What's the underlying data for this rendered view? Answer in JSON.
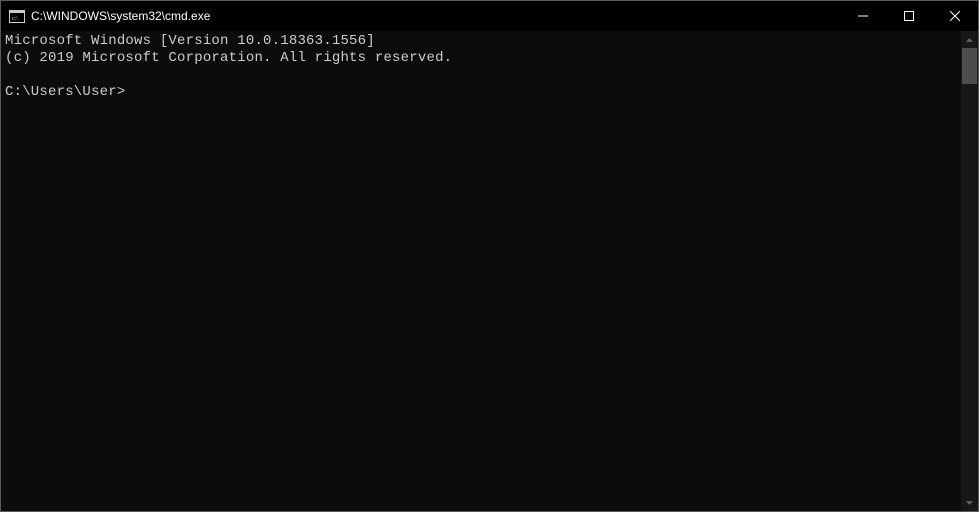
{
  "window": {
    "title": "C:\\WINDOWS\\system32\\cmd.exe"
  },
  "terminal": {
    "line1": "Microsoft Windows [Version 10.0.18363.1556]",
    "line2": "(c) 2019 Microsoft Corporation. All rights reserved.",
    "blank": "",
    "prompt": "C:\\Users\\User>"
  }
}
